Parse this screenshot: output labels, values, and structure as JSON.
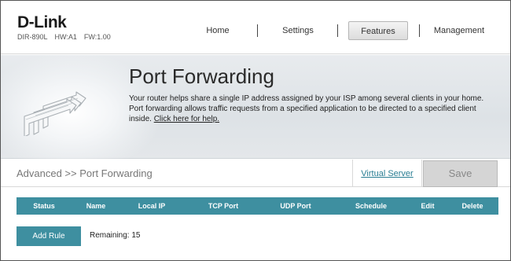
{
  "brand": {
    "logo": "D-Link",
    "model": "DIR-890L",
    "hw": "HW:A1",
    "fw": "FW:1.00"
  },
  "nav": {
    "home": "Home",
    "settings": "Settings",
    "features": "Features",
    "management": "Management",
    "active": "Features"
  },
  "banner": {
    "title": "Port Forwarding",
    "description": "Your router helps share a single IP address assigned by your ISP among several clients in your home. Port forwarding allows traffic requests from a specified application to be directed to a specified client inside.",
    "help_link": "Click here for help."
  },
  "breadcrumb": "Advanced >> Port Forwarding",
  "virtual_server_link": "Virtual Server",
  "save_label": "Save",
  "table": {
    "columns": [
      "Status",
      "Name",
      "Local IP",
      "TCP Port",
      "UDP Port",
      "Schedule",
      "Edit",
      "Delete"
    ]
  },
  "add_rule_label": "Add Rule",
  "remaining": "Remaining: 15",
  "colors": {
    "accent": "#3e8fa0",
    "link": "#2a7e94",
    "save_disabled": "#d5d5d5"
  }
}
